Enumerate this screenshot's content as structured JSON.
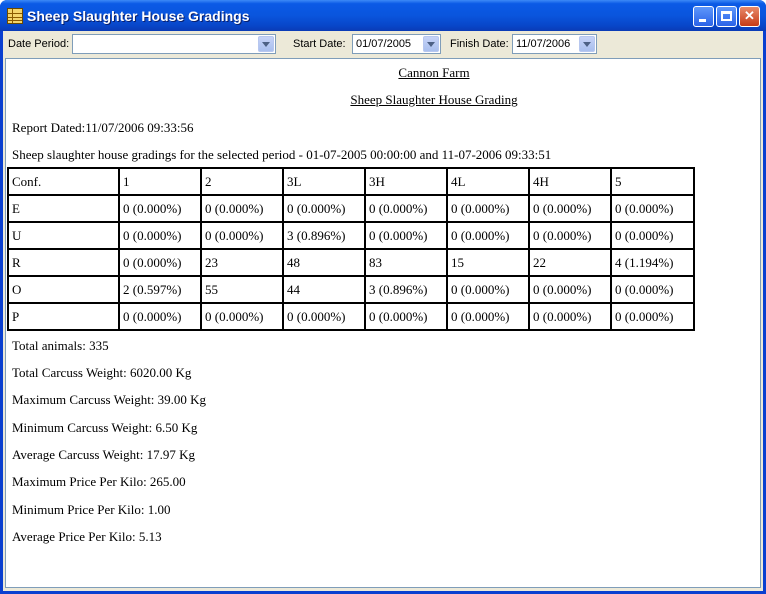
{
  "window": {
    "title": "Sheep Slaughter House Gradings"
  },
  "toolbar": {
    "date_period_label": "Date Period:",
    "date_period_value": "",
    "start_date_label": "Start Date:",
    "start_date_value": "01/07/2005",
    "finish_date_label": "Finish Date:",
    "finish_date_value": "11/07/2006"
  },
  "report": {
    "farm_name": "Cannon Farm",
    "report_title": "Sheep Slaughter House Grading",
    "report_dated": "Report Dated:11/07/2006 09:33:56",
    "period_text": "Sheep slaughter house gradings for the selected period - 01-07-2005 00:00:00 and 11-07-2006 09:33:51",
    "table": {
      "header": [
        "Conf.",
        "1",
        "2",
        "3L",
        "3H",
        "4L",
        "4H",
        "5"
      ],
      "rows": [
        [
          "E",
          "0 (0.000%)",
          "0 (0.000%)",
          "0 (0.000%)",
          "0 (0.000%)",
          "0 (0.000%)",
          "0 (0.000%)",
          "0 (0.000%)"
        ],
        [
          "U",
          "0 (0.000%)",
          "0 (0.000%)",
          "3 (0.896%)",
          "0 (0.000%)",
          "0 (0.000%)",
          "0 (0.000%)",
          "0 (0.000%)"
        ],
        [
          "R",
          "0 (0.000%)",
          "23",
          "48",
          "83",
          "15",
          "22",
          "4 (1.194%)"
        ],
        [
          "O",
          "2 (0.597%)",
          "55",
          "44",
          "3 (0.896%)",
          "0 (0.000%)",
          "0 (0.000%)",
          "0 (0.000%)"
        ],
        [
          "P",
          "0 (0.000%)",
          "0 (0.000%)",
          "0 (0.000%)",
          "0 (0.000%)",
          "0 (0.000%)",
          "0 (0.000%)",
          "0 (0.000%)"
        ]
      ]
    },
    "summary": {
      "total_animals": "Total animals: 335",
      "total_weight": "Total Carcuss Weight: 6020.00 Kg",
      "max_weight": "Maximum Carcuss Weight: 39.00 Kg",
      "min_weight": "Minimum Carcuss Weight: 6.50 Kg",
      "avg_weight": "Average Carcuss Weight: 17.97 Kg",
      "max_price": "Maximum Price Per Kilo: 265.00",
      "min_price": "Minimum Price Per Kilo: 1.00",
      "avg_price": "Average Price Per Kilo: 5.13"
    }
  }
}
